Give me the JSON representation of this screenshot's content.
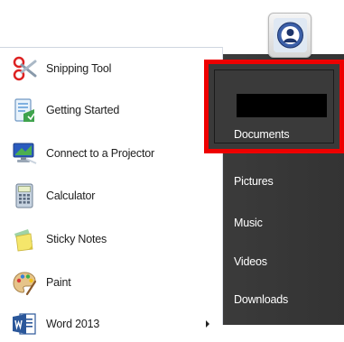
{
  "programs": [
    {
      "label": "Snipping Tool",
      "icon": "scissors-icon"
    },
    {
      "label": "Getting Started",
      "icon": "getting-started-icon"
    },
    {
      "label": "Connect to a Projector",
      "icon": "projector-icon"
    },
    {
      "label": "Calculator",
      "icon": "calculator-icon"
    },
    {
      "label": "Sticky Notes",
      "icon": "sticky-notes-icon"
    },
    {
      "label": "Paint",
      "icon": "paint-palette-icon"
    },
    {
      "label": "Word 2013",
      "icon": "word-icon"
    }
  ],
  "places": {
    "documents": "Documents",
    "pictures": "Pictures",
    "music": "Music",
    "videos": "Videos",
    "downloads": "Downloads"
  },
  "colors": {
    "highlight_frame": "#ee0000",
    "right_pane": "#383838"
  }
}
